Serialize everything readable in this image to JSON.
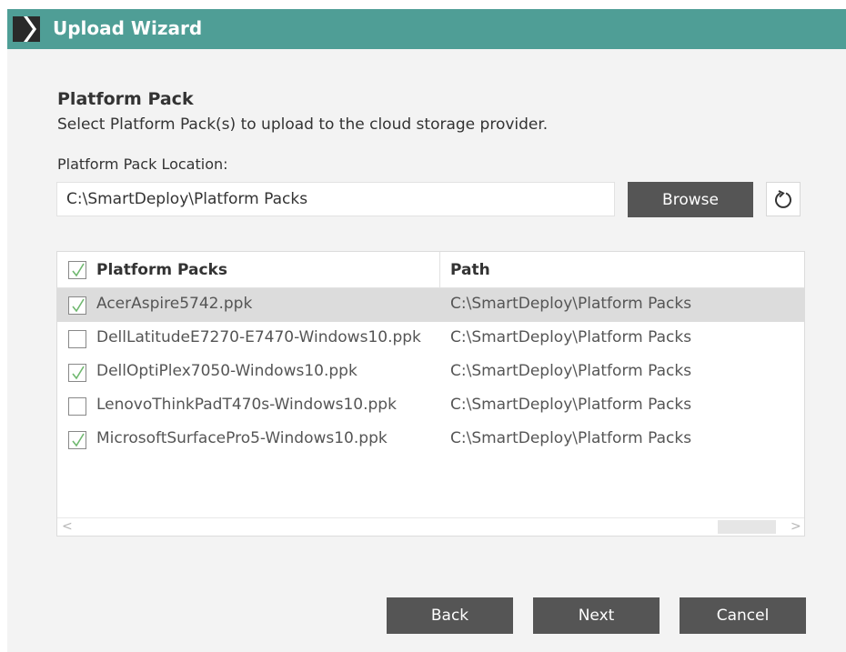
{
  "window": {
    "title": "Upload Wizard",
    "logo_icon": "chevron-logo-icon",
    "accent_color": "#4f9e96",
    "button_color": "#555555"
  },
  "page": {
    "heading": "Platform Pack",
    "subtitle": "Select Platform Pack(s) to upload to the cloud storage provider."
  },
  "location": {
    "label": "Platform Pack Location:",
    "value": "C:\\SmartDeploy\\Platform Packs",
    "browse_label": "Browse",
    "refresh_icon": "refresh-icon"
  },
  "grid": {
    "columns": [
      "Platform Packs",
      "Path"
    ],
    "header_checked": true,
    "rows": [
      {
        "name": "AcerAspire5742.ppk",
        "path": "C:\\SmartDeploy\\Platform Packs",
        "checked": true,
        "selected": true
      },
      {
        "name": "DellLatitudeE7270-E7470-Windows10.ppk",
        "path": "C:\\SmartDeploy\\Platform Packs",
        "checked": false,
        "selected": false
      },
      {
        "name": "DellOptiPlex7050-Windows10.ppk",
        "path": "C:\\SmartDeploy\\Platform Packs",
        "checked": true,
        "selected": false
      },
      {
        "name": "LenovoThinkPadT470s-Windows10.ppk",
        "path": "C:\\SmartDeploy\\Platform Packs",
        "checked": false,
        "selected": false
      },
      {
        "name": "MicrosoftSurfacePro5-Windows10.ppk",
        "path": "C:\\SmartDeploy\\Platform Packs",
        "checked": true,
        "selected": false
      }
    ],
    "scroll_left_icon": "<",
    "scroll_right_icon": ">"
  },
  "footer": {
    "back_label": "Back",
    "next_label": "Next",
    "cancel_label": "Cancel"
  }
}
